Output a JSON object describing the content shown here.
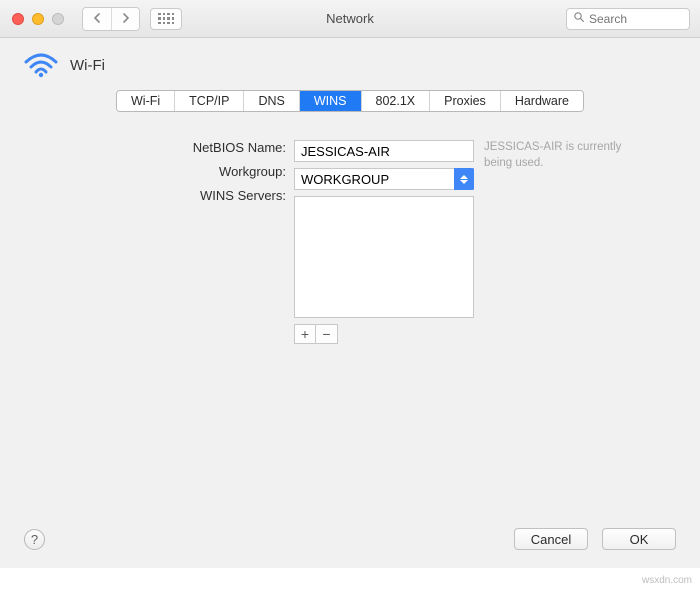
{
  "window": {
    "title": "Network"
  },
  "search": {
    "placeholder": "Search"
  },
  "header": {
    "title": "Wi-Fi"
  },
  "tabs": [
    {
      "label": "Wi-Fi",
      "selected": false
    },
    {
      "label": "TCP/IP",
      "selected": false
    },
    {
      "label": "DNS",
      "selected": false
    },
    {
      "label": "WINS",
      "selected": true
    },
    {
      "label": "802.1X",
      "selected": false
    },
    {
      "label": "Proxies",
      "selected": false
    },
    {
      "label": "Hardware",
      "selected": false
    }
  ],
  "labels": {
    "netbios": "NetBIOS Name:",
    "workgroup": "Workgroup:",
    "wins_servers": "WINS Servers:"
  },
  "fields": {
    "netbios_value": "JESSICAS-AIR",
    "workgroup_value": "WORKGROUP",
    "wins_servers": []
  },
  "hint": "JESSICAS-AIR is currently being used.",
  "buttons": {
    "add": "+",
    "remove": "−",
    "help": "?",
    "cancel": "Cancel",
    "ok": "OK"
  },
  "watermark": "wsxdn.com"
}
